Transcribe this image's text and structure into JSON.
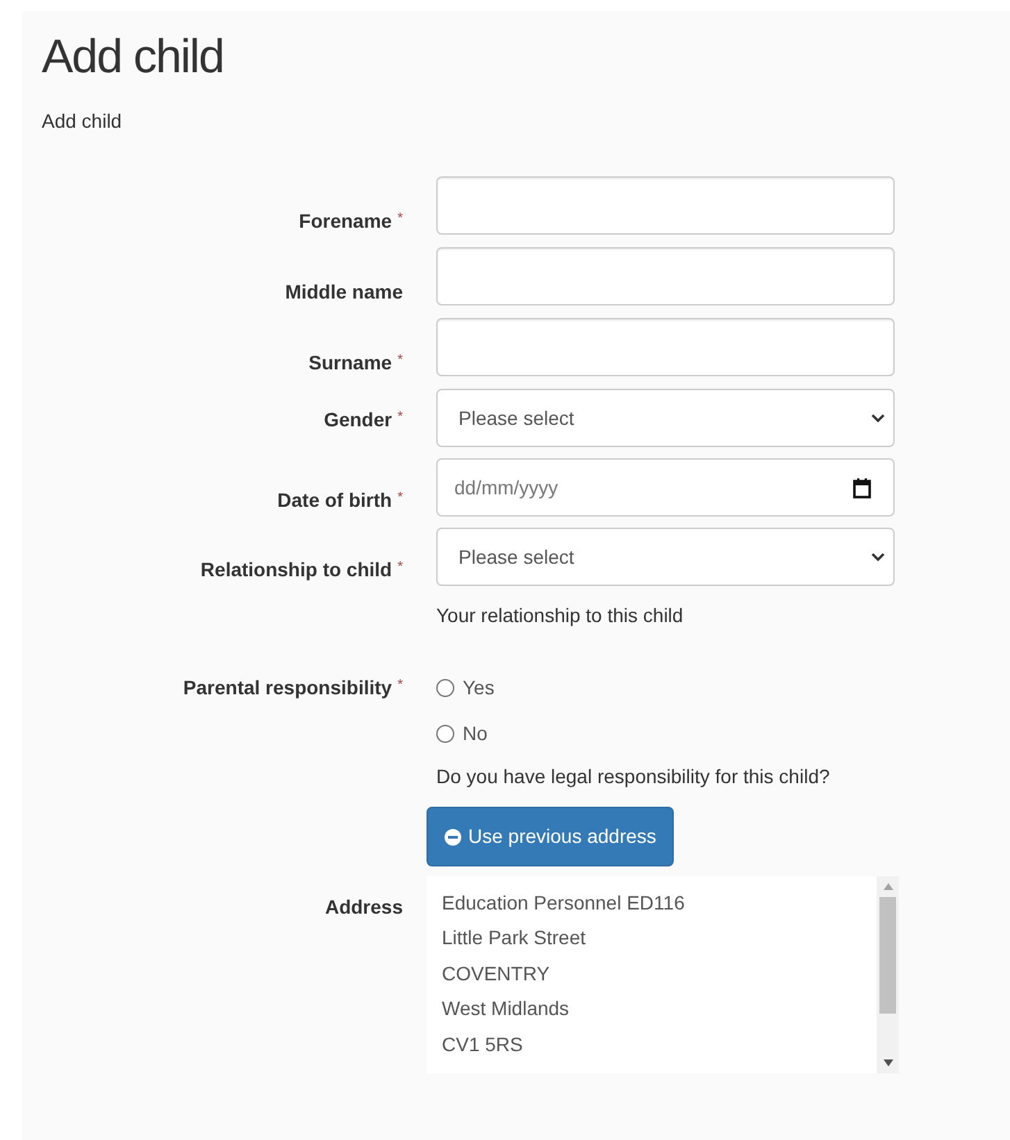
{
  "title": "Add child",
  "subtitle": "Add child",
  "fields": [
    {
      "kind": "text",
      "label": "Forename",
      "marker": "*"
    },
    {
      "kind": "text",
      "label": "Middle name"
    },
    {
      "kind": "text",
      "label": "Surname",
      "marker": "*"
    },
    {
      "kind": "select",
      "label": "Gender",
      "marker": "*",
      "value": "Please select"
    },
    {
      "kind": "date",
      "label": "Date of birth",
      "marker": "*",
      "placeholder": "dd/mm/yyyy"
    },
    {
      "kind": "select",
      "label": "Relationship to child",
      "marker": "*",
      "value": "Please select",
      "help": "Your relationship to this child"
    }
  ],
  "parental_responsibility": {
    "label": "Parental responsibility",
    "marker": "*",
    "options": [
      {
        "label": "Yes",
        "selected": false
      },
      {
        "label": "No",
        "selected": false
      }
    ],
    "help": "Do you have legal responsibility for this child?"
  },
  "address_button": "Use previous address",
  "address": {
    "label": "Address",
    "lines": [
      "Education Personnel ED116",
      "Little Park Street",
      "COVENTRY",
      "West Midlands",
      "CV1 5RS"
    ]
  }
}
